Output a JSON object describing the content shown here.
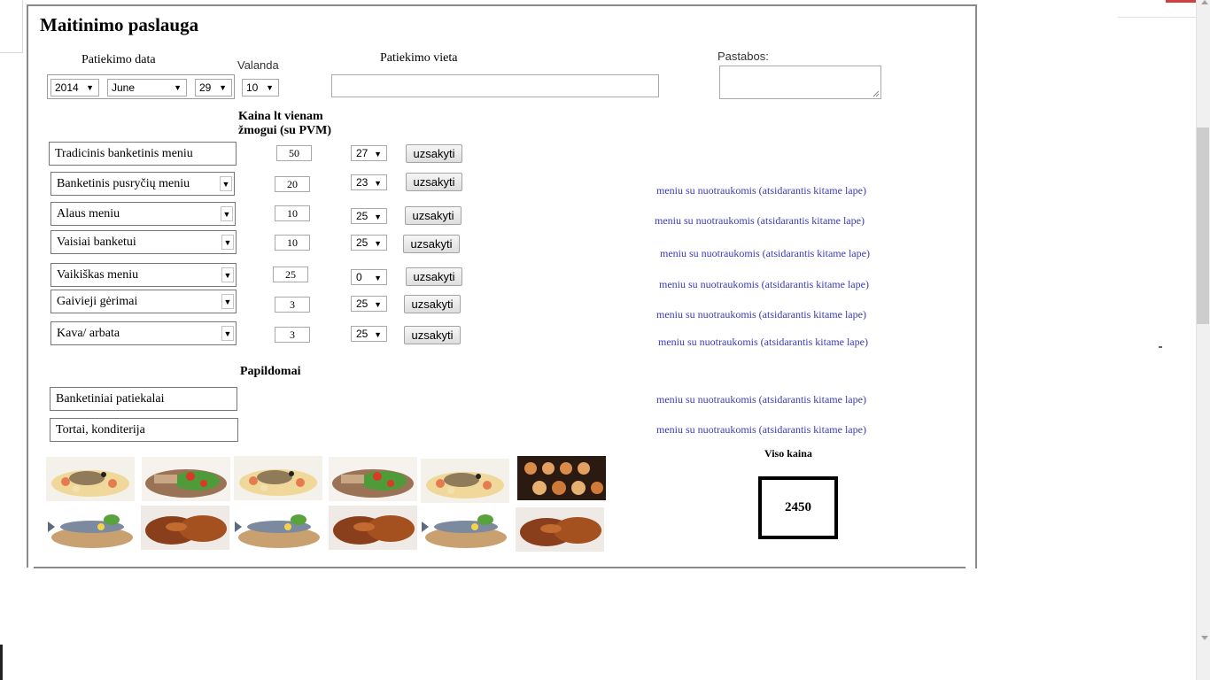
{
  "title": "Maitinimo paslauga",
  "date_section": {
    "label": "Patiekimo data",
    "year": "2014",
    "month": "June",
    "day": "29"
  },
  "hour_section": {
    "label": "Valanda",
    "value": "10"
  },
  "place_section": {
    "label": "Patiekimo vieta",
    "value": ""
  },
  "notes_section": {
    "label": "Pastabos:",
    "value": ""
  },
  "price_header": "Kaina  lt vienam žmogui (su PVM)",
  "menu_rows": [
    {
      "name": "Tradicinis banketinis meniu",
      "price": "50",
      "qty": "27",
      "button": "uzsakyti",
      "link": ""
    },
    {
      "name": "Banketinis pusryčių meniu",
      "price": "20",
      "qty": "23",
      "button": "uzsakyti",
      "link": "meniu su nuotraukomis (atsidarantis kitame lape)"
    },
    {
      "name": "Alaus meniu",
      "price": "10",
      "qty": "25",
      "button": "uzsakyti",
      "link": "meniu su nuotraukomis (atsidarantis kitame lape)"
    },
    {
      "name": "Vaisiai banketui",
      "price": "10",
      "qty": "25",
      "button": "uzsakyti",
      "link": "meniu su nuotraukomis (atsidarantis kitame lape)"
    },
    {
      "name": "Vaikiškas meniu",
      "price": "25",
      "qty": "0",
      "button": "uzsakyti",
      "link": "meniu su nuotraukomis (atsidarantis kitame lape)"
    },
    {
      "name": "Gaivieji gėrimai",
      "price": "3",
      "qty": "25",
      "button": "uzsakyti",
      "link": "meniu su nuotraukomis (atsidarantis kitame lape)"
    },
    {
      "name": "Kava/ arbata",
      "price": "3",
      "qty": "25",
      "button": "uzsakyti",
      "link": "meniu su nuotraukomis (atsidarantis kitame lape)"
    }
  ],
  "extras_header": "Papildomai",
  "extras": [
    {
      "name": "Banketiniai patiekalai",
      "link": "meniu su nuotraukomis (atsidarantis kitame lape)"
    },
    {
      "name": "Tortai, konditerija",
      "link": "meniu su nuotraukomis (atsidarantis kitame lape)"
    }
  ],
  "total": {
    "label": "Viso kaina",
    "value": "2450"
  },
  "colors": {
    "link": "#3a3ab8",
    "frame": "#8a8a8a",
    "button_top": "#f6f6f6",
    "button_bottom": "#dedede"
  },
  "icons": {
    "dropdown": "chevron-down-icon"
  }
}
